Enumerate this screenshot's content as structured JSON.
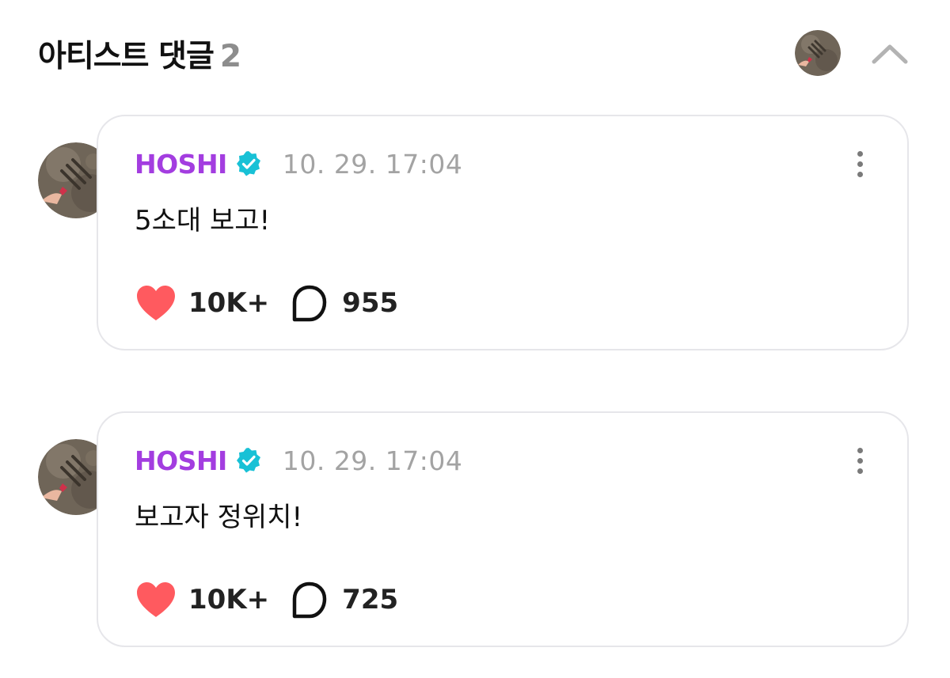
{
  "section": {
    "title": "아티스트 댓글",
    "count": "2"
  },
  "comments": [
    {
      "author": "HOSHI",
      "timestamp": "10. 29. 17:04",
      "text": "5소대 보고!",
      "likes": "10K+",
      "replies": "955"
    },
    {
      "author": "HOSHI",
      "timestamp": "10. 29. 17:04",
      "text": "보고자 정위치!",
      "likes": "10K+",
      "replies": "725"
    }
  ],
  "icons": {
    "collapse": "chevron-up-icon",
    "verified": "verified-badge-icon",
    "more": "more-vertical-icon",
    "like": "heart-icon",
    "reply": "speech-bubble-icon"
  },
  "colors": {
    "author": "#a33de0",
    "verified": "#18c1d6",
    "heart": "#ff5a5f",
    "timestamp": "#a3a3a3",
    "card_border": "#e6e6ea",
    "count_muted": "#8d8d8d"
  }
}
